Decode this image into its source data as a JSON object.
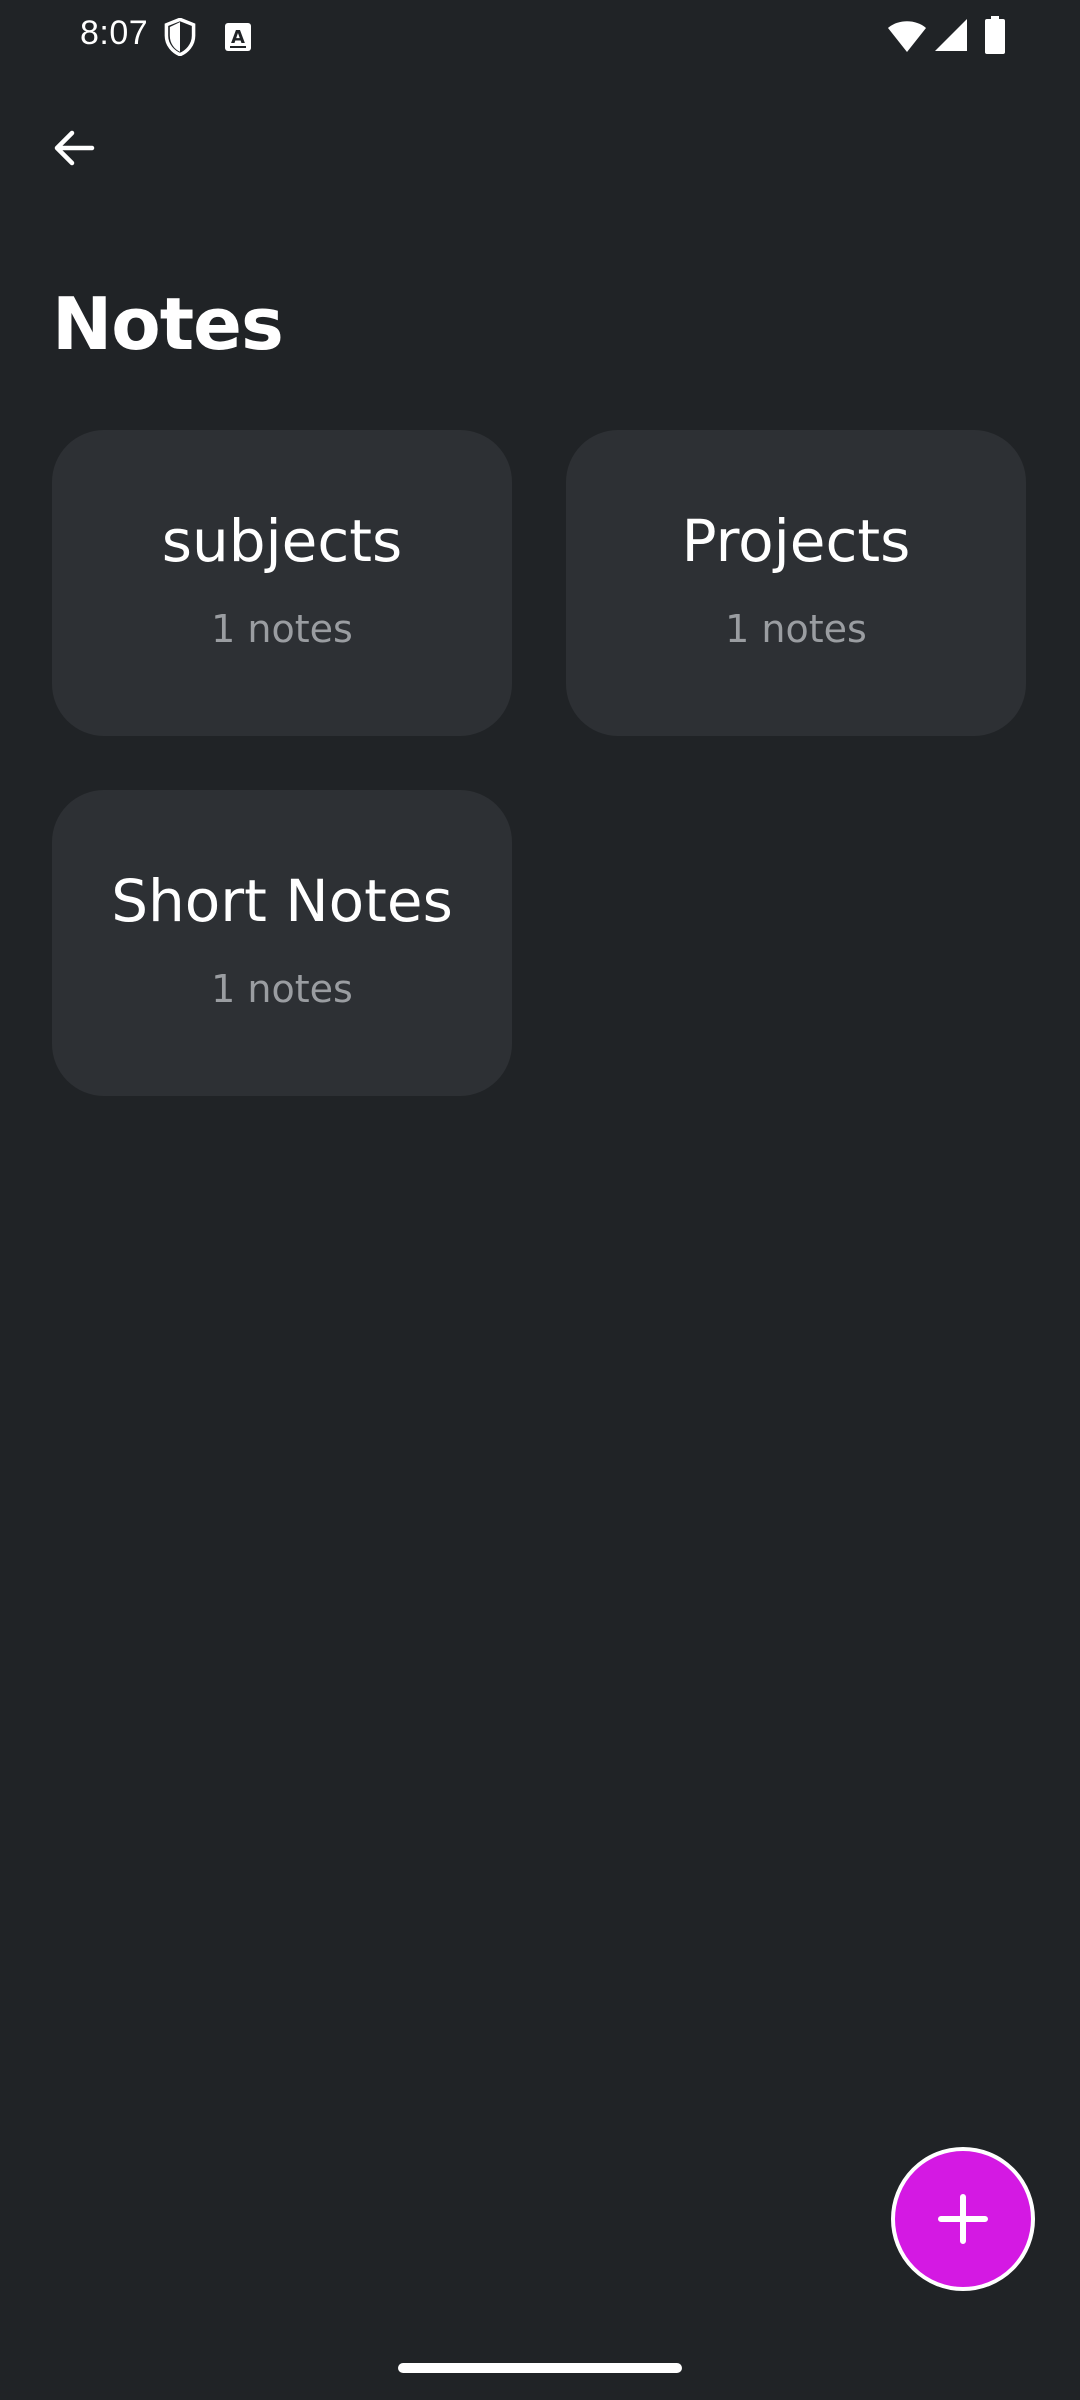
{
  "status_bar": {
    "time": "8:07",
    "icons": [
      "shield-icon",
      "text-a-icon",
      "wifi-icon",
      "signal-icon",
      "battery-icon"
    ]
  },
  "app_bar": {
    "back_icon": "arrow-left-icon"
  },
  "page": {
    "title": "Notes"
  },
  "folders": [
    {
      "name": "subjects",
      "count": "1 notes"
    },
    {
      "name": "Projects",
      "count": "1 notes"
    },
    {
      "name": "Short Notes",
      "count": "1 notes"
    }
  ],
  "fab": {
    "icon": "plus-icon"
  },
  "colors": {
    "background": "#202326",
    "card": "#2d3034",
    "accent": "#d419e3",
    "secondary_text": "#9a9da1"
  }
}
